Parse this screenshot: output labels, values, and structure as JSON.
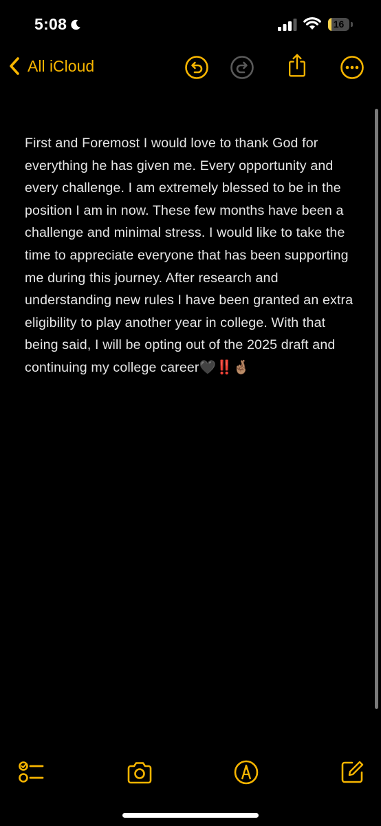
{
  "status_bar": {
    "time": "5:08",
    "battery_level": "16",
    "battery_fraction": 0.16,
    "icons": [
      "moon-icon",
      "cellular-signal-icon",
      "wifi-icon",
      "battery-icon"
    ]
  },
  "nav": {
    "back_label": "All iCloud",
    "icons": [
      "chevron-left-icon",
      "undo-icon",
      "redo-icon",
      "share-icon",
      "more-icon"
    ]
  },
  "note": {
    "text": "First and Foremost I would love to thank God for everything he has given me. Every opportunity and every challenge. I am extremely blessed to be in the position I am in now. These few months have been a challenge and minimal stress. I would like to take the time to appreciate everyone that has been supporting me during this journey. After research and understanding new rules I have been granted an extra eligibility to play another year in college. With that being said, I will be opting out of the 2025 draft and continuing my college career🖤‼️🤞🏽"
  },
  "toolbar": {
    "icons": [
      "checklist-icon",
      "camera-icon",
      "markup-icon",
      "compose-icon"
    ]
  },
  "colors": {
    "accent": "#f7b500",
    "background": "#000000",
    "text": "#e6e6e6",
    "disabled": "#5a5a5a",
    "battery_fill": "#f7d24a"
  }
}
